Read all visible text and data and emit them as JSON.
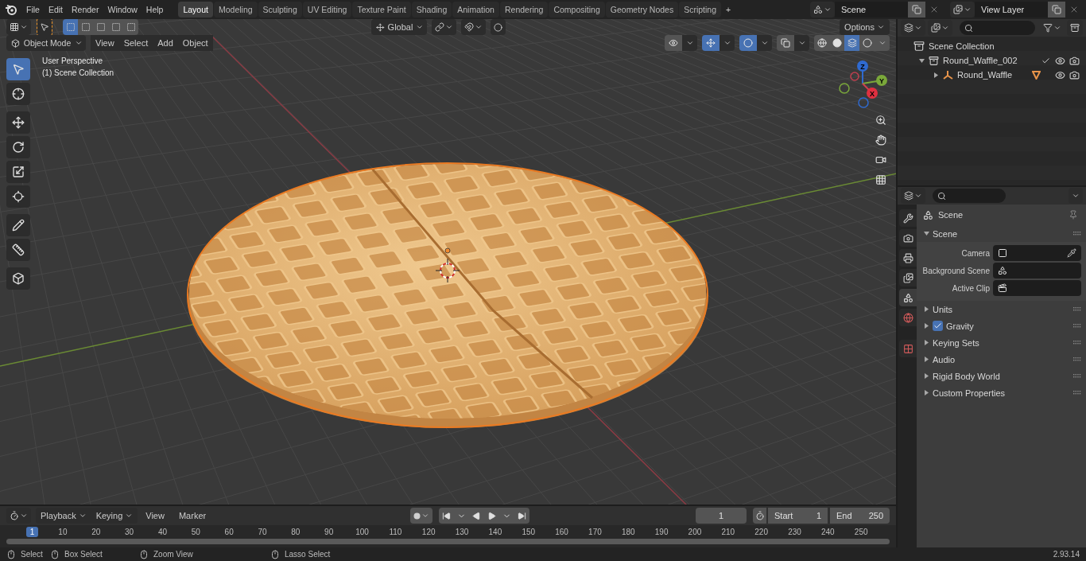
{
  "top_bar": {
    "menus": [
      "File",
      "Edit",
      "Render",
      "Window",
      "Help"
    ],
    "workspaces": [
      {
        "label": "Layout",
        "selected": true
      },
      {
        "label": "Modeling",
        "selected": false
      },
      {
        "label": "Sculpting",
        "selected": false
      },
      {
        "label": "UV Editing",
        "selected": false
      },
      {
        "label": "Texture Paint",
        "selected": false
      },
      {
        "label": "Shading",
        "selected": false
      },
      {
        "label": "Animation",
        "selected": false
      },
      {
        "label": "Rendering",
        "selected": false
      },
      {
        "label": "Compositing",
        "selected": false
      },
      {
        "label": "Geometry Nodes",
        "selected": false
      },
      {
        "label": "Scripting",
        "selected": false
      }
    ],
    "add_workspace": "+",
    "scene": "Scene",
    "view_layer": "View Layer"
  },
  "viewport": {
    "select_modes": [
      {
        "selected": true
      },
      {
        "selected": false
      },
      {
        "selected": false
      },
      {
        "selected": false
      },
      {
        "selected": false
      }
    ],
    "orientation": "Global",
    "options": "Options",
    "mode": "Object Mode",
    "menus": [
      "View",
      "Select",
      "Add",
      "Object"
    ],
    "toggles": [
      {
        "kind": "visibility",
        "on": false
      },
      {
        "kind": "gizmos",
        "on": true
      },
      {
        "kind": "overlays",
        "on": true
      },
      {
        "kind": "xray",
        "on": false
      }
    ],
    "shading": [
      {
        "kind": "wireframe",
        "selected": false
      },
      {
        "kind": "solid",
        "selected": false
      },
      {
        "kind": "material",
        "selected": true
      },
      {
        "kind": "rendered",
        "selected": false
      }
    ],
    "view_name": "User Perspective",
    "collection_label": "(1) Scene Collection",
    "tools": [
      {
        "kind": "select",
        "selected": true
      },
      {
        "kind": "cursor",
        "selected": false
      },
      {
        "kind": "move",
        "selected": false
      },
      {
        "kind": "rotate",
        "selected": false
      },
      {
        "kind": "scale",
        "selected": false
      },
      {
        "kind": "transform",
        "selected": false
      },
      {
        "kind": "annotate",
        "selected": false
      },
      {
        "kind": "measure",
        "selected": false
      },
      {
        "kind": "add_cube",
        "selected": false
      }
    ],
    "gizmo": {
      "x": "X",
      "y": "Y",
      "z": "Z"
    }
  },
  "outliner": {
    "root": "Scene Collection",
    "items": [
      {
        "kind": "collection",
        "label": "Round_Waffle_002",
        "expanded": true,
        "checked": true,
        "children": [
          {
            "kind": "object",
            "label": "Round_Waffle",
            "expanded": false
          }
        ]
      }
    ]
  },
  "properties": {
    "tabs": [
      {
        "kind": "tool",
        "selected": false
      },
      {
        "kind": "render",
        "selected": false
      },
      {
        "kind": "output",
        "selected": false
      },
      {
        "kind": "view_layer",
        "selected": false
      },
      {
        "kind": "scene",
        "selected": true
      },
      {
        "kind": "world",
        "selected": false
      },
      {
        "kind": "texture",
        "selected": false
      }
    ],
    "context": "Scene",
    "panels": [
      {
        "label": "Scene",
        "expanded": true,
        "fields": [
          {
            "kind": "camera",
            "label": "Camera"
          },
          {
            "kind": "scene",
            "label": "Background Scene"
          },
          {
            "kind": "clip",
            "label": "Active Clip"
          }
        ]
      },
      {
        "label": "Units",
        "expanded": false
      },
      {
        "label": "Gravity",
        "expanded": false,
        "checked": true
      },
      {
        "label": "Keying Sets",
        "expanded": false
      },
      {
        "label": "Audio",
        "expanded": false
      },
      {
        "label": "Rigid Body World",
        "expanded": false
      },
      {
        "label": "Custom Properties",
        "expanded": false
      }
    ]
  },
  "timeline": {
    "menus": [
      "Playback",
      "Keying"
    ],
    "links": [
      "View",
      "Marker"
    ],
    "recording": false,
    "current_frame": "1",
    "start_label": "Start",
    "start": "1",
    "end_label": "End",
    "end": "250",
    "frame_marker": "1",
    "ticks": [
      "10",
      "20",
      "30",
      "40",
      "50",
      "60",
      "70",
      "80",
      "90",
      "100",
      "110",
      "120",
      "130",
      "140",
      "150",
      "160",
      "170",
      "180",
      "190",
      "200",
      "210",
      "220",
      "230",
      "240",
      "250"
    ]
  },
  "status_bar": {
    "hints": [
      "Select",
      "Box Select",
      "Zoom View",
      "Lasso Select"
    ],
    "version": "2.93.14"
  }
}
